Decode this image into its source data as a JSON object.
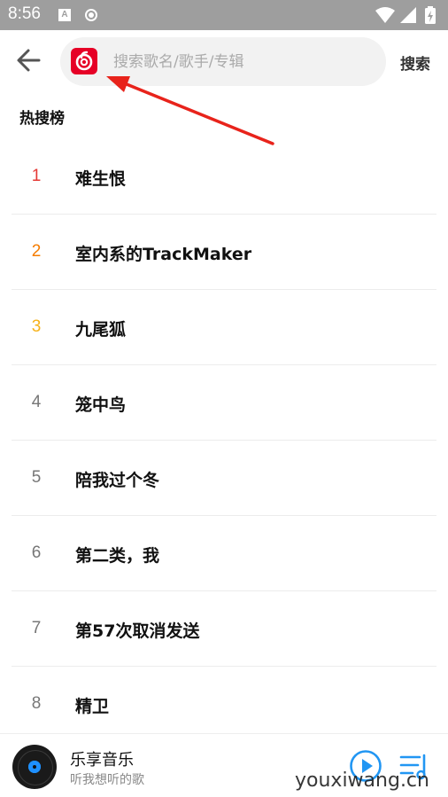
{
  "status_bar": {
    "time": "8:56",
    "icons": [
      "a-notification-icon",
      "record-icon",
      "wifi-icon",
      "signal-icon",
      "battery-charging-icon"
    ]
  },
  "header": {
    "back_icon": "arrow-left-icon",
    "logo": "netease-cloud-music-logo",
    "search_placeholder": "搜索歌名/歌手/专辑",
    "search_value": "",
    "search_button": "搜索"
  },
  "hot_search": {
    "title": "热搜榜",
    "items": [
      {
        "rank": "1",
        "title": "难生恨",
        "rank_color": "#e53935"
      },
      {
        "rank": "2",
        "title": "室内系的TrackMaker",
        "rank_color": "#f57c00"
      },
      {
        "rank": "3",
        "title": "九尾狐",
        "rank_color": "#f6b21a"
      },
      {
        "rank": "4",
        "title": "笼中鸟",
        "rank_color": "#777777"
      },
      {
        "rank": "5",
        "title": "陪我过个冬",
        "rank_color": "#777777"
      },
      {
        "rank": "6",
        "title": "第二类，我",
        "rank_color": "#777777"
      },
      {
        "rank": "7",
        "title": "第57次取消发送",
        "rank_color": "#777777"
      },
      {
        "rank": "8",
        "title": "精卫",
        "rank_color": "#777777"
      }
    ]
  },
  "player": {
    "title": "乐享音乐",
    "subtitle": "听我想听的歌",
    "play_icon": "play-circle-icon",
    "playlist_icon": "playlist-icon"
  },
  "watermark": "youxiwang.cn",
  "colors": {
    "accent_red": "#e60026",
    "annotation_arrow": "#e8231b",
    "play_blue": "#2196f3"
  }
}
